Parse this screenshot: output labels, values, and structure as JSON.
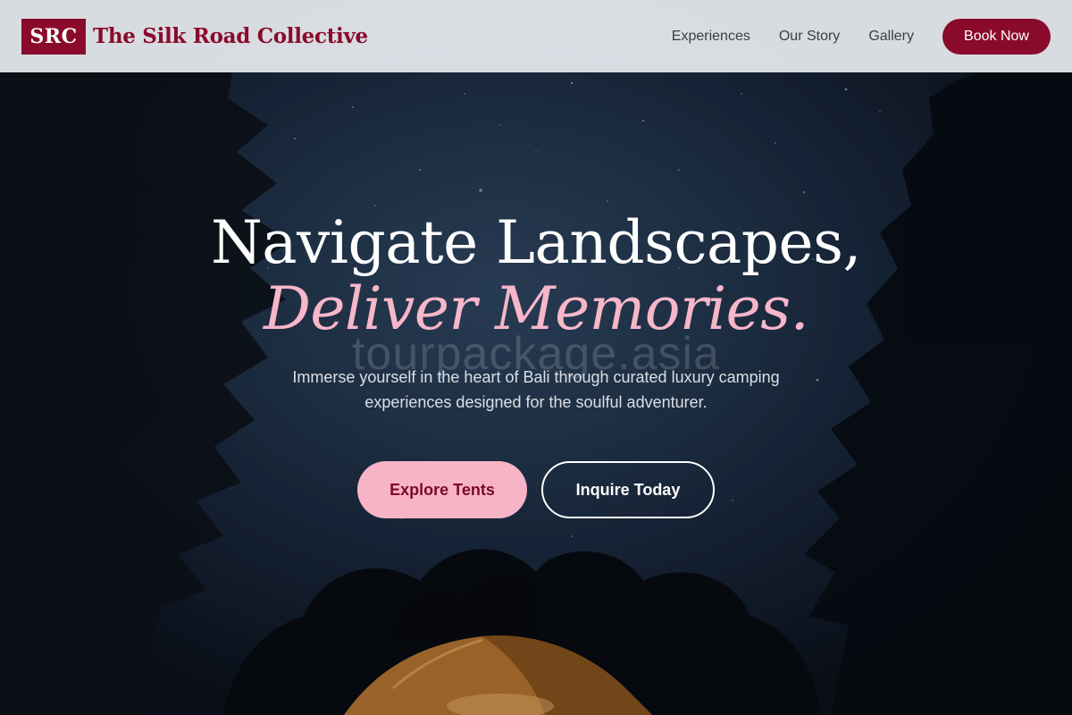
{
  "header": {
    "logo_mark": "SRC",
    "brand_name": "The Silk Road Collective",
    "nav": [
      {
        "label": "Experiences"
      },
      {
        "label": "Our Story"
      },
      {
        "label": "Gallery"
      }
    ],
    "cta_label": "Book Now"
  },
  "hero": {
    "headline_line1": "Navigate Landscapes,",
    "headline_line2": "Deliver Memories.",
    "watermark": "tourpackage.asia",
    "subtitle": "Immerse yourself in the heart of Bali through curated luxury camping experiences designed for the soulful adventurer.",
    "primary_cta": "Explore Tents",
    "secondary_cta": "Inquire Today",
    "background_icon": "night-sky-tent-image"
  },
  "colors": {
    "brand": "#8a0a2b",
    "accent_pink": "#f8b4c7",
    "header_bg": "#e4e7eb"
  }
}
